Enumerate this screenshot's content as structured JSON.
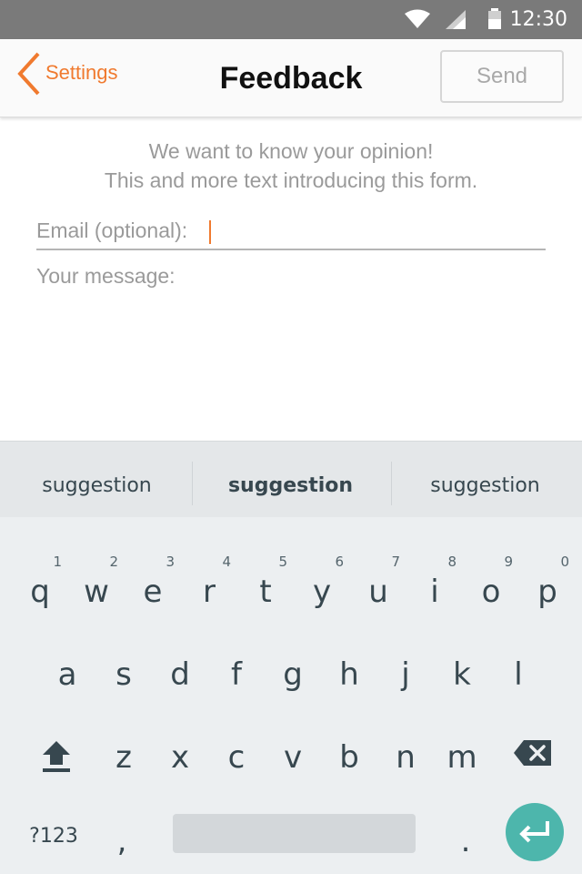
{
  "status_bar": {
    "time": "12:30",
    "icons": [
      "wifi-icon",
      "signal-icon",
      "battery-icon"
    ],
    "background": "#7a7a7a"
  },
  "action_bar": {
    "back_label": "Settings",
    "title": "Feedback",
    "send_label": "Send",
    "accent": "#f07a2f"
  },
  "form": {
    "intro_line1": "We want to know your opinion!",
    "intro_line2": "This and more text introducing this form.",
    "email_label": "Email (optional):",
    "email_value": "",
    "message_label": "Your message:",
    "message_value": ""
  },
  "keyboard": {
    "suggestions": [
      "suggestion",
      "suggestion",
      "suggestion"
    ],
    "row1": [
      {
        "key": "q",
        "hint": "1"
      },
      {
        "key": "w",
        "hint": "2"
      },
      {
        "key": "e",
        "hint": "3"
      },
      {
        "key": "r",
        "hint": "4"
      },
      {
        "key": "t",
        "hint": "5"
      },
      {
        "key": "y",
        "hint": "6"
      },
      {
        "key": "u",
        "hint": "7"
      },
      {
        "key": "i",
        "hint": "8"
      },
      {
        "key": "o",
        "hint": "9"
      },
      {
        "key": "p",
        "hint": "0"
      }
    ],
    "row2": [
      "a",
      "s",
      "d",
      "f",
      "g",
      "h",
      "j",
      "k",
      "l"
    ],
    "row3": [
      "z",
      "x",
      "c",
      "v",
      "b",
      "n",
      "m"
    ],
    "symbols_label": "?123",
    "comma": ",",
    "period": ".",
    "enter_color": "#4db6ac"
  }
}
